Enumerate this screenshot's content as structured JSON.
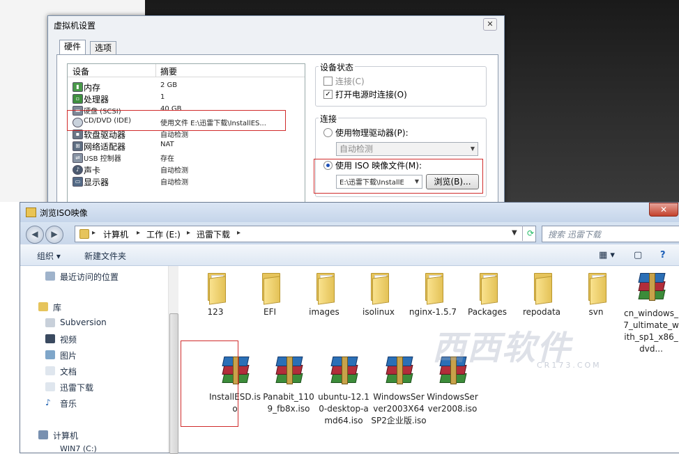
{
  "vm_dialog": {
    "title": "虚拟机设置",
    "close_label": "✕",
    "tabs": [
      "硬件",
      "选项"
    ],
    "device_list": {
      "headers": [
        "设备",
        "摘要"
      ],
      "rows": [
        {
          "icon": "memory-icon",
          "name": "内存",
          "summary": "2 GB"
        },
        {
          "icon": "cpu-icon",
          "name": "处理器",
          "summary": "1"
        },
        {
          "icon": "harddisk-icon",
          "name": "硬盘 (SCSI)",
          "summary": "40 GB"
        },
        {
          "icon": "cdrom-icon",
          "name": "CD/DVD (IDE)",
          "summary": "使用文件 E:\\迅雷下载\\InstallES..."
        },
        {
          "icon": "floppy-icon",
          "name": "软盘驱动器",
          "summary": "自动检测"
        },
        {
          "icon": "network-adapter-icon",
          "name": "网络适配器",
          "summary": "NAT"
        },
        {
          "icon": "usb-icon",
          "name": "USB 控制器",
          "summary": "存在"
        },
        {
          "icon": "sound-card-icon",
          "name": "声卡",
          "summary": "自动检测"
        },
        {
          "icon": "display-icon",
          "name": "显示器",
          "summary": "自动检测"
        }
      ]
    },
    "device_status": {
      "title": "设备状态",
      "connected_label": "连接(C)",
      "connect_on_power_label": "打开电源时连接(O)",
      "connect_on_power_check": "✓"
    },
    "connection": {
      "title": "连接",
      "physical_drive_label": "使用物理驱动器(P):",
      "physical_drive_value": "自动检测",
      "iso_label": "使用 ISO 映像文件(M):",
      "iso_value": "E:\\迅雷下载\\InstallE",
      "browse_label": "浏览(B)..."
    }
  },
  "file_browser": {
    "title": "浏览ISO映像",
    "close_label": "✕",
    "back_label": "◀",
    "forward_label": "▶",
    "breadcrumb": [
      "计算机",
      "工作 (E:)",
      "迅雷下载"
    ],
    "search_placeholder": "搜索 迅雷下载",
    "toolbar": {
      "organize_label": "组织 ▾",
      "new_folder_label": "新建文件夹"
    },
    "nav": {
      "recent": "最近访问的位置",
      "library": "库",
      "library_items": [
        "Subversion",
        "视频",
        "图片",
        "文档",
        "迅雷下载",
        "音乐"
      ],
      "computer": "计算机",
      "drive_partial": "WIN7 (C:)"
    },
    "files": [
      {
        "name": "123",
        "type": "folder"
      },
      {
        "name": "EFI",
        "type": "folder"
      },
      {
        "name": "images",
        "type": "folder"
      },
      {
        "name": "isolinux",
        "type": "folder"
      },
      {
        "name": "nginx-1.5.7",
        "type": "folder"
      },
      {
        "name": "Packages",
        "type": "folder"
      },
      {
        "name": "repodata",
        "type": "folder"
      },
      {
        "name": "svn",
        "type": "folder"
      },
      {
        "name": "cn_windows_7_ultimate_with_sp1_x86_dvd...",
        "type": "iso"
      },
      {
        "name": "InstallESD.iso",
        "type": "iso"
      },
      {
        "name": "Panabit_1109_fb8x.iso",
        "type": "iso"
      },
      {
        "name": "ubuntu-12.10-desktop-amd64.iso",
        "type": "iso"
      },
      {
        "name": "WindowsServer2003X64SP2企业版.iso",
        "type": "iso"
      },
      {
        "name": "WindowsServer2008.iso",
        "type": "iso"
      }
    ]
  },
  "watermark": {
    "text": "西西软件",
    "sub": "CR173.COM"
  },
  "colors": {
    "highlight_box": "#d02b2b",
    "accent": "#1c4fb8"
  }
}
